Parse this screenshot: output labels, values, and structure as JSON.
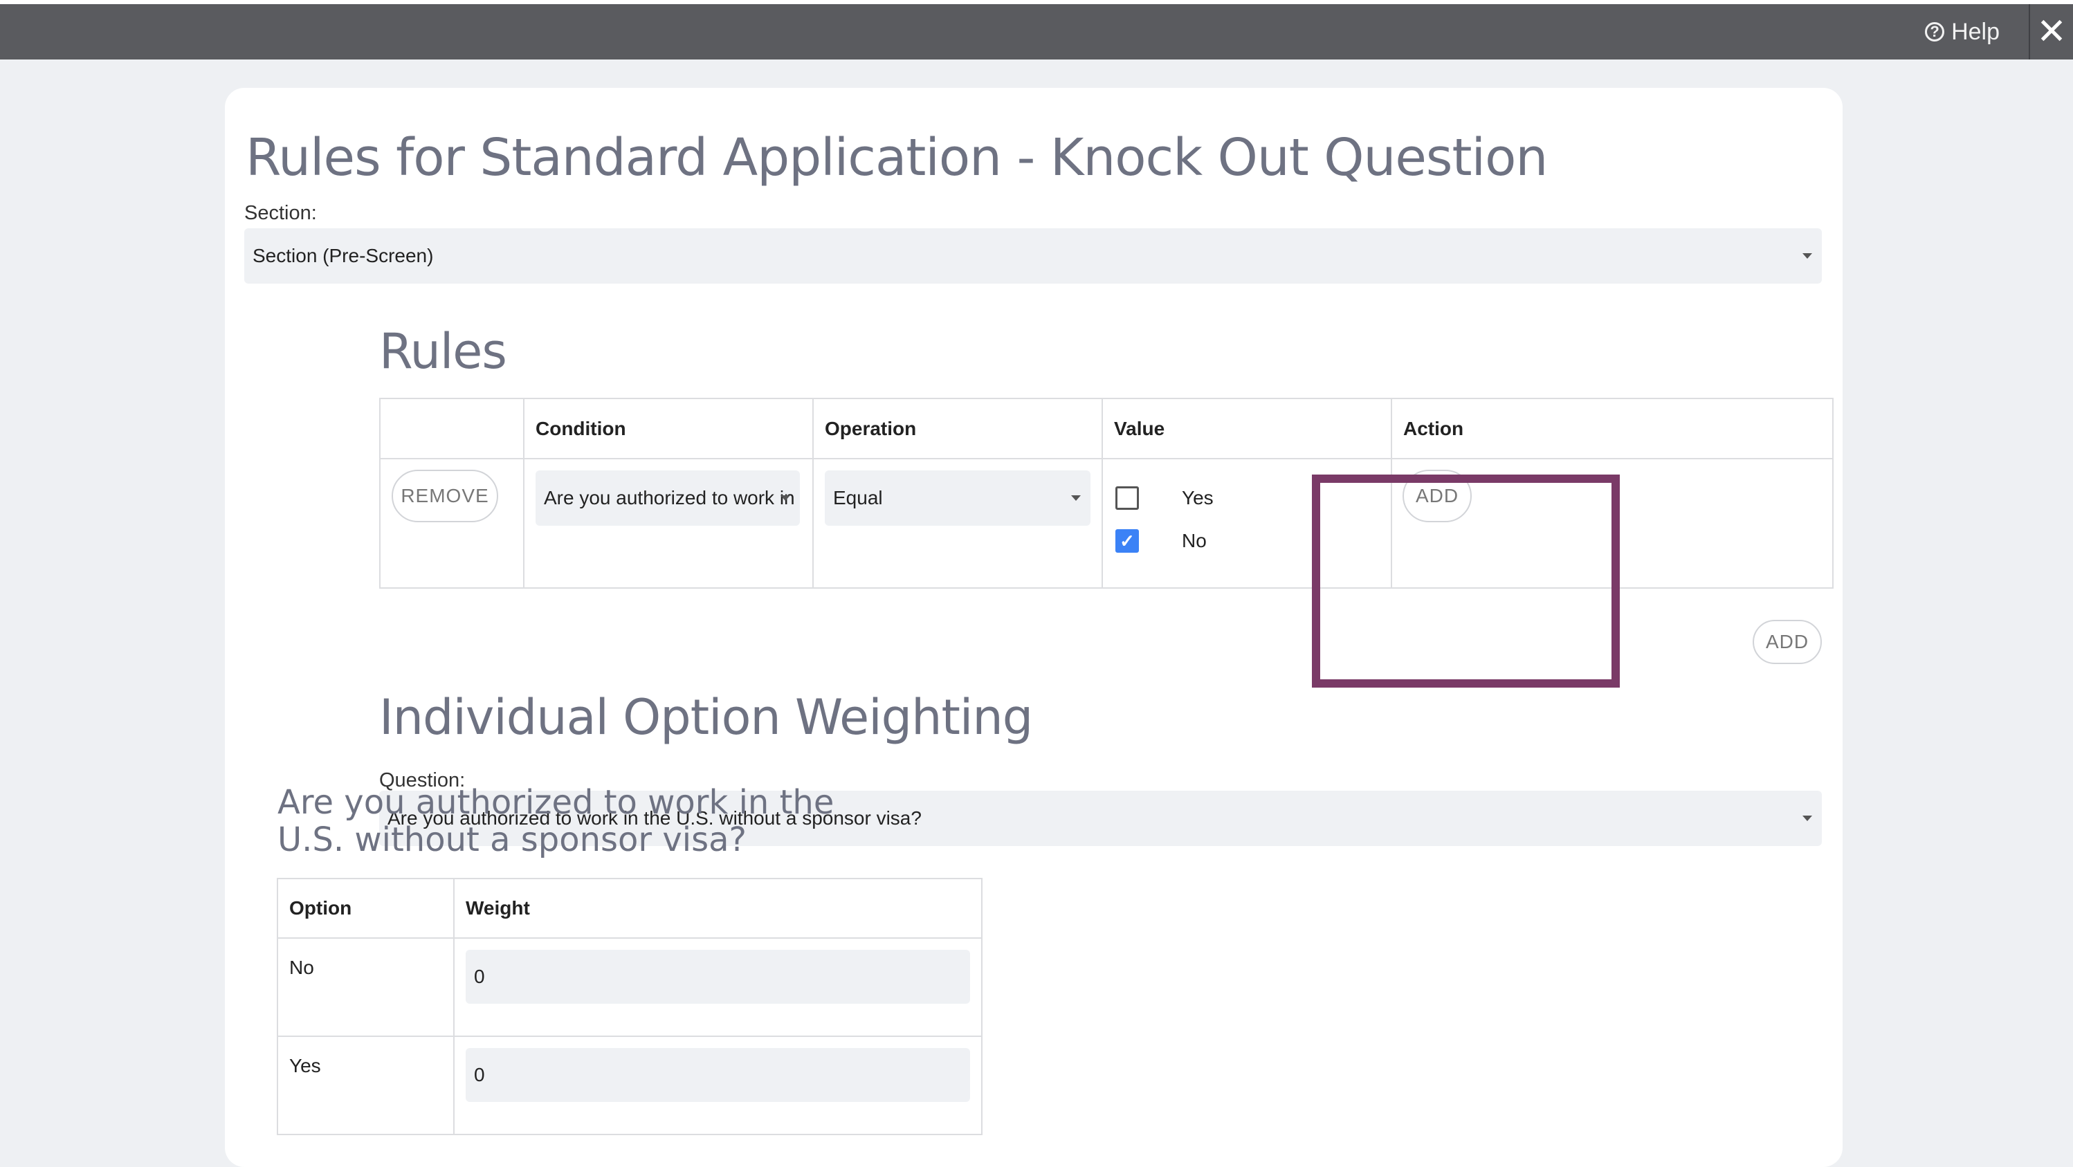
{
  "topbar": {
    "help_label": "Help",
    "help_icon": "?",
    "close_icon": "✕"
  },
  "page": {
    "title": "Rules for Standard Application - Knock Out Question",
    "section_label": "Section:",
    "section_value": "Section (Pre-Screen)"
  },
  "rules": {
    "heading": "Rules",
    "columns": {
      "blank": "",
      "condition": "Condition",
      "operation": "Operation",
      "value": "Value",
      "action": "Action"
    },
    "row": {
      "remove_label": "REMOVE",
      "condition_value": "Are you authorized to work in the U.S. without a sponsor visa?",
      "operation_value": "Equal",
      "options": [
        {
          "label": "Yes",
          "checked": false
        },
        {
          "label": "No",
          "checked": true
        }
      ],
      "action_add_label": "ADD"
    },
    "add_rule_label": "ADD"
  },
  "weighting": {
    "heading": "Individual Option Weighting",
    "question_label": "Question:",
    "question_value": "Are you authorized to work in the U.S. without a sponsor visa?",
    "question_title": "Are you authorized to work in the U.S. without a sponsor visa?",
    "columns": {
      "option": "Option",
      "weight": "Weight"
    },
    "rows": [
      {
        "option": "No",
        "weight": "0"
      },
      {
        "option": "Yes",
        "weight": "0"
      }
    ]
  },
  "colors": {
    "highlight": "#7a3a67",
    "topbar": "#5a5b5f",
    "checkbox_checked": "#3b82f6"
  }
}
